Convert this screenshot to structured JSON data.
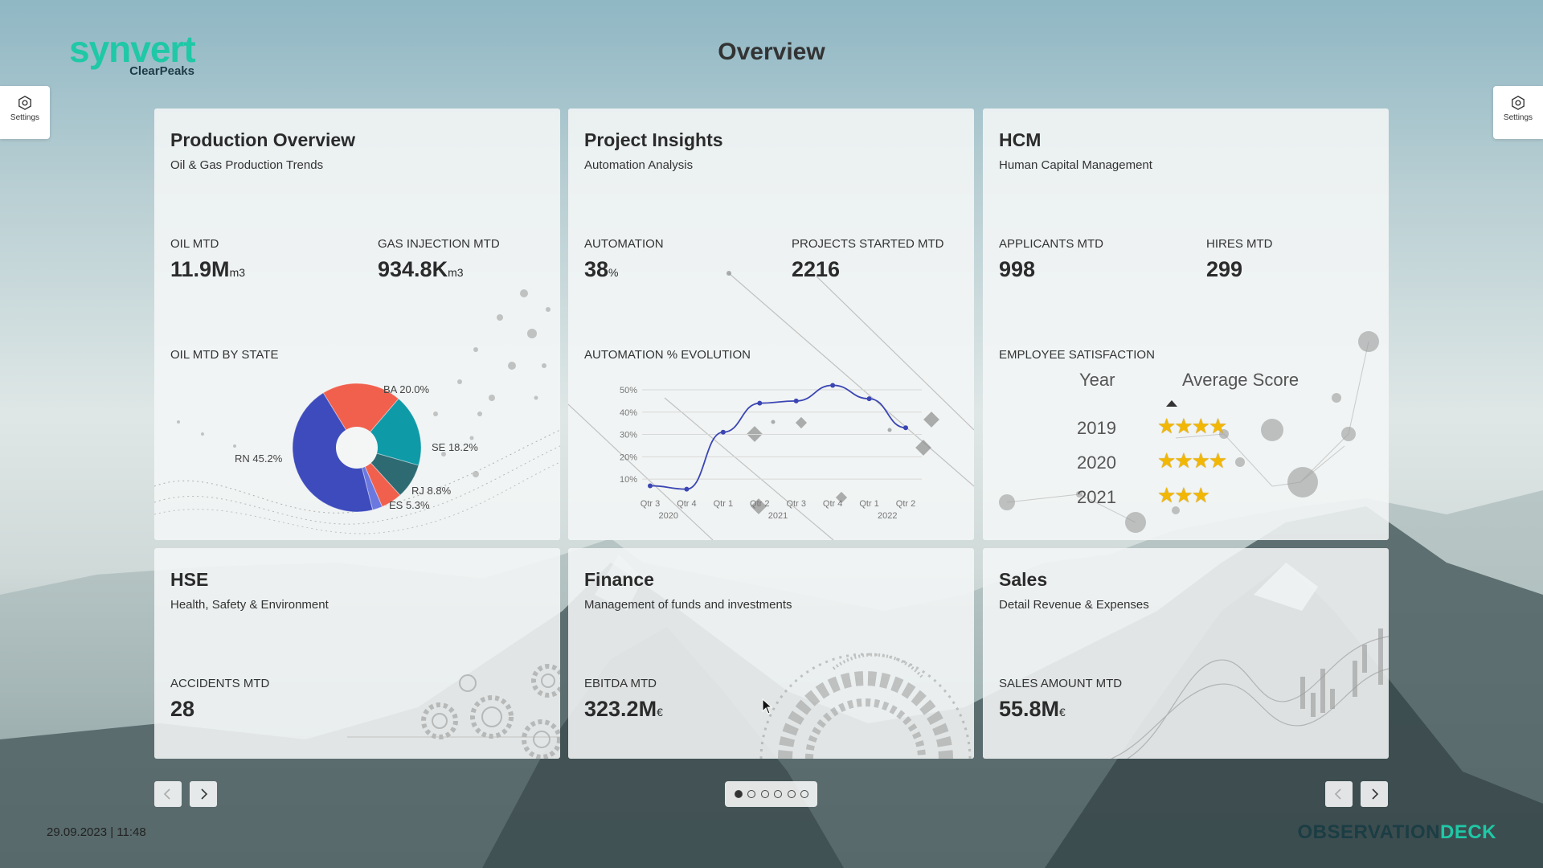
{
  "header": {
    "logo_text": "synvert",
    "logo_sub": "ClearPeaks",
    "title": "Overview"
  },
  "settings": {
    "left_label": "Settings",
    "right_label": "Settings"
  },
  "tiles": {
    "production": {
      "title": "Production Overview",
      "subtitle": "Oil & Gas Production Trends",
      "kpi1": {
        "label": "OIL MTD",
        "value": "11.9M",
        "unit": "m3"
      },
      "kpi2": {
        "label": "GAS INJECTION MTD",
        "value": "934.8K",
        "unit": "m3"
      },
      "section": "OIL MTD BY STATE",
      "chart_data": {
        "type": "pie",
        "donut": true,
        "slices": [
          {
            "label": "RN",
            "value": 45.2,
            "display": "RN 45.2%",
            "color": "#3d4bbd"
          },
          {
            "label": "BA",
            "value": 20.0,
            "display": "BA 20.0%",
            "color": "#f0604d"
          },
          {
            "label": "SE",
            "value": 18.2,
            "display": "SE 18.2%",
            "color": "#0e9aa7"
          },
          {
            "label": "RJ",
            "value": 8.8,
            "display": "RJ 8.8%",
            "color": "#2e6a72"
          },
          {
            "label": "ES",
            "value": 5.3,
            "display": "ES 5.3%",
            "color": "#f0604d"
          },
          {
            "label": "other",
            "value": 2.5,
            "display": "",
            "color": "#6b78e0"
          }
        ]
      }
    },
    "project": {
      "title": "Project Insights",
      "subtitle": "Automation Analysis",
      "kpi1": {
        "label": "AUTOMATION",
        "value": "38",
        "unit": "%"
      },
      "kpi2": {
        "label": "PROJECTS STARTED MTD",
        "value": "2216",
        "unit": ""
      },
      "section": "AUTOMATION % EVOLUTION",
      "chart_data": {
        "type": "line",
        "y_ticks": [
          "10%",
          "20%",
          "30%",
          "40%",
          "50%"
        ],
        "ylim": [
          5,
          50
        ],
        "x": [
          "Qtr 3",
          "Qtr 4",
          "Qtr 1",
          "Qtr 2",
          "Qtr 3",
          "Qtr 4",
          "Qtr 1",
          "Qtr 2"
        ],
        "year_labels": [
          "2020",
          "2021",
          "2022"
        ],
        "series": [
          {
            "values": [
              7,
              5.5,
              31,
              44,
              45,
              52,
              46,
              33
            ],
            "color": "#3b46b4"
          }
        ]
      }
    },
    "hcm": {
      "title": "HCM",
      "subtitle": "Human Capital Management",
      "kpi1": {
        "label": "APPLICANTS MTD",
        "value": "998",
        "unit": ""
      },
      "kpi2": {
        "label": "HIRES MTD",
        "value": "299",
        "unit": ""
      },
      "section": "EMPLOYEE SATISFACTION",
      "table": {
        "headers": [
          "Year",
          "Average Score"
        ],
        "rows": [
          {
            "year": "2019",
            "stars": 4
          },
          {
            "year": "2020",
            "stars": 4
          },
          {
            "year": "2021",
            "stars": 3
          }
        ]
      }
    },
    "hse": {
      "title": "HSE",
      "subtitle": "Health, Safety & Environment",
      "kpi1": {
        "label": "ACCIDENTS MTD",
        "value": "28",
        "unit": ""
      }
    },
    "finance": {
      "title": "Finance",
      "subtitle": "Management of funds and investments",
      "kpi1": {
        "label": "EBITDA MTD",
        "value": "323.2M",
        "unit": "€"
      }
    },
    "sales": {
      "title": "Sales",
      "subtitle": "Detail Revenue & Expenses",
      "kpi1": {
        "label": "SALES AMOUNT MTD",
        "value": "55.8M",
        "unit": "€"
      }
    }
  },
  "pager": {
    "pages": 6,
    "active": 0
  },
  "footer": {
    "datetime": "29.09.2023 | 11:48",
    "brand_a": "OBSERVATION",
    "brand_b": "DECK"
  }
}
